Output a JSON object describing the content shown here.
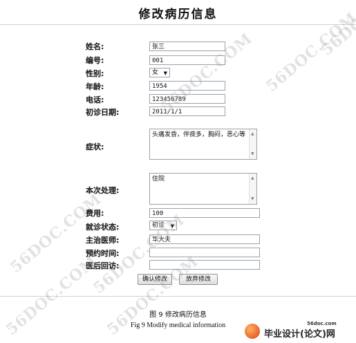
{
  "page_title": "修改病历信息",
  "labels": {
    "name": "姓名:",
    "number": "编号:",
    "gender": "性别:",
    "age": "年龄:",
    "phone": "电话:",
    "first_visit_date": "初诊日期:",
    "symptoms": "症状:",
    "treatment": "本次处理:",
    "cost": "费用:",
    "visit_status": "就诊状态:",
    "doctor": "主治医师:",
    "appointment_time": "预约时间:",
    "followup": "医后回访:"
  },
  "values": {
    "name": "张三",
    "number": "001",
    "gender": "女",
    "age": "1954",
    "phone": "123456789",
    "first_visit_date": "2011/1/1",
    "symptoms": "头痛发昏，伴痰多，胸闷，恶心等",
    "treatment": "住院",
    "cost": "100",
    "visit_status": "初诊",
    "doctor": "华大夫",
    "appointment_time": "",
    "followup": ""
  },
  "buttons": {
    "confirm": "确认修改",
    "discard": "放弃修改"
  },
  "captions": {
    "cn": "图 9    修改病历信息",
    "en": "Fig 9 Modify medical information"
  },
  "watermark": "56DOC.COM",
  "brand": {
    "url": "56doc.com",
    "name": "毕业设计(论文)网"
  }
}
